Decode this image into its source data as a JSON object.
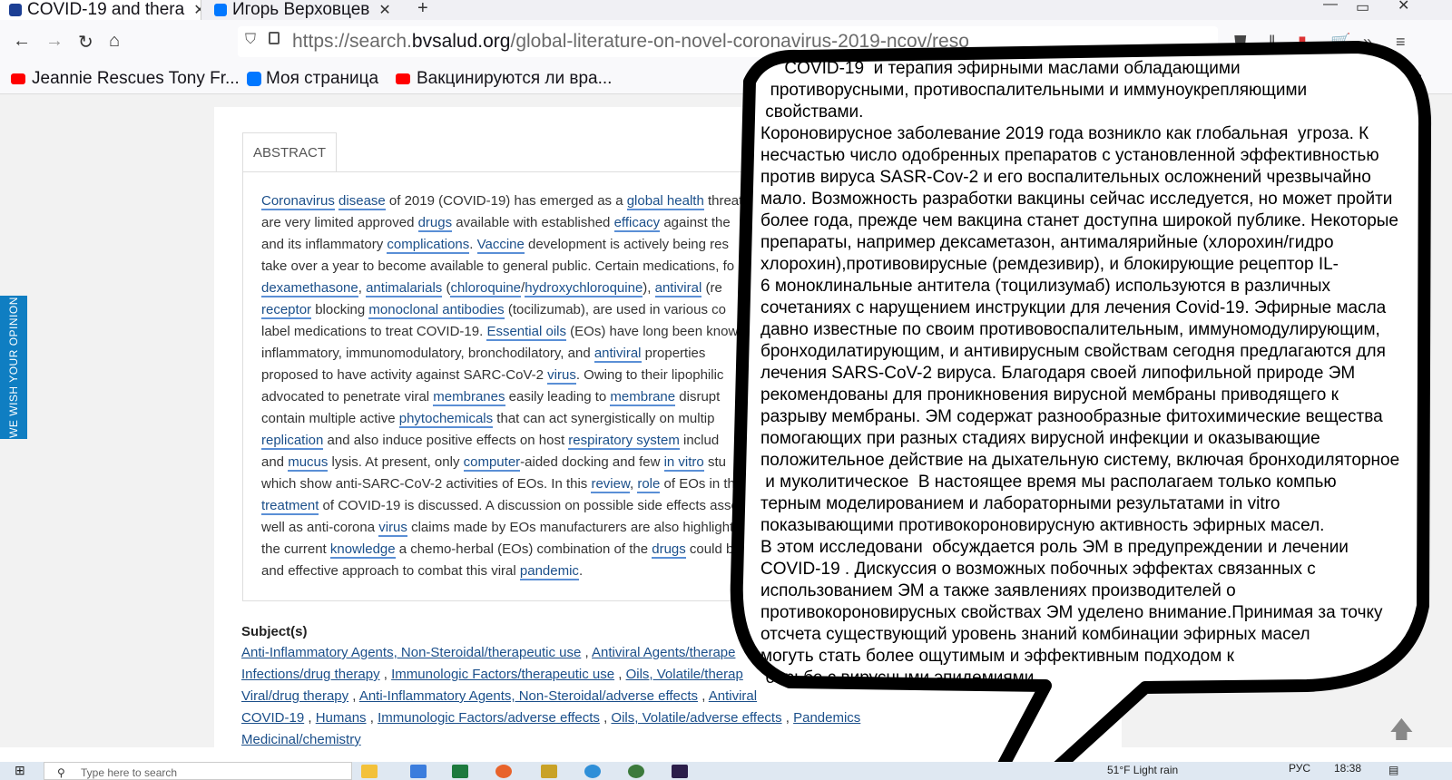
{
  "browser": {
    "tabs": [
      {
        "title": "COVID-19 and thera"
      },
      {
        "title": "Игорь Верховцев"
      }
    ],
    "new_tab": "+",
    "url_prefix": "https://search.",
    "url_domain": "bvsalud.org",
    "url_suffix": "/global-literature-on-novel-coronavirus-2019-ncov/reso",
    "bookmarks": [
      {
        "label": "Jeannie Rescues Tony Fr...",
        "icon": "youtube-icon"
      },
      {
        "label": "Моя страница",
        "icon": "vk-icon"
      },
      {
        "label": "Вакцинируются ли вра...",
        "icon": "youtube-icon"
      }
    ],
    "bookmarks_overflow": "ks"
  },
  "page": {
    "feedback_label": "WE WISH YOUR OPINION",
    "abstract_tab": "ABSTRACT",
    "abstract_lines": [
      [
        {
          "t": "Coronavirus",
          "k": true
        },
        {
          "t": " "
        },
        {
          "t": "disease",
          "k": true
        },
        {
          "t": " of 2019 (COVID-19) has emerged as a "
        },
        {
          "t": "global health",
          "k": true
        },
        {
          "t": " threat."
        }
      ],
      [
        {
          "t": "are very limited approved "
        },
        {
          "t": "drugs",
          "k": true
        },
        {
          "t": " available with established "
        },
        {
          "t": "efficacy",
          "k": true
        },
        {
          "t": " against the"
        }
      ],
      [
        {
          "t": "and its inflammatory "
        },
        {
          "t": "complications",
          "k": true
        },
        {
          "t": ". "
        },
        {
          "t": "Vaccine",
          "k": true
        },
        {
          "t": " development is actively being res"
        }
      ],
      [
        {
          "t": "take over a year to become available to general public. Certain medications, fo"
        }
      ],
      [
        {
          "t": "dexamethasone",
          "k": true
        },
        {
          "t": ", "
        },
        {
          "t": "antimalarials",
          "k": true
        },
        {
          "t": " ("
        },
        {
          "t": "chloroquine",
          "k": true
        },
        {
          "t": "/"
        },
        {
          "t": "hydroxychloroquine",
          "k": true
        },
        {
          "t": "), "
        },
        {
          "t": "antiviral",
          "k": true
        },
        {
          "t": " (re"
        }
      ],
      [
        {
          "t": "receptor",
          "k": true
        },
        {
          "t": " blocking "
        },
        {
          "t": "monoclonal antibodies",
          "k": true
        },
        {
          "t": " (tocilizumab), are used in various co"
        }
      ],
      [
        {
          "t": "label medications to treat COVID-19. "
        },
        {
          "t": "Essential oils",
          "k": true
        },
        {
          "t": " (EOs) have long been know"
        }
      ],
      [
        {
          "t": "inflammatory, immunomodulatory, bronchodilatory, and "
        },
        {
          "t": "antiviral",
          "k": true
        },
        {
          "t": " properties"
        }
      ],
      [
        {
          "t": "proposed to have activity against SARC-CoV-2 "
        },
        {
          "t": "virus",
          "k": true
        },
        {
          "t": ". Owing to their lipophilic"
        }
      ],
      [
        {
          "t": "advocated to penetrate viral "
        },
        {
          "t": "membranes",
          "k": true
        },
        {
          "t": " easily leading to "
        },
        {
          "t": "membrane",
          "k": true
        },
        {
          "t": " disrupt"
        }
      ],
      [
        {
          "t": "contain multiple active "
        },
        {
          "t": "phytochemicals",
          "k": true
        },
        {
          "t": " that can act synergistically on multip"
        }
      ],
      [
        {
          "t": "replication",
          "k": true
        },
        {
          "t": " and also induce positive effects on host "
        },
        {
          "t": "respiratory system",
          "k": true
        },
        {
          "t": " includ"
        }
      ],
      [
        {
          "t": "and "
        },
        {
          "t": "mucus",
          "k": true
        },
        {
          "t": " lysis. At present, only "
        },
        {
          "t": "computer",
          "k": true
        },
        {
          "t": "-aided docking and few "
        },
        {
          "t": "in vitro",
          "k": true
        },
        {
          "t": " stu"
        }
      ],
      [
        {
          "t": "which show anti-SARC-CoV-2 activities of EOs. In this "
        },
        {
          "t": "review",
          "k": true
        },
        {
          "t": ", "
        },
        {
          "t": "role",
          "k": true
        },
        {
          "t": " of EOs in the"
        }
      ],
      [
        {
          "t": "treatment",
          "k": true
        },
        {
          "t": " of COVID-19 is discussed. A discussion on possible side effects asso"
        }
      ],
      [
        {
          "t": "well as anti-corona "
        },
        {
          "t": "virus",
          "k": true
        },
        {
          "t": " claims made by EOs manufacturers are also highlight"
        }
      ],
      [
        {
          "t": "the current "
        },
        {
          "t": "knowledge",
          "k": true
        },
        {
          "t": " a chemo-herbal (EOs) combination of the "
        },
        {
          "t": "drugs",
          "k": true
        },
        {
          "t": " could b"
        }
      ],
      [
        {
          "t": "and effective approach to combat this viral "
        },
        {
          "t": "pandemic",
          "k": true
        },
        {
          "t": "."
        }
      ]
    ],
    "subjects_title": "Subject(s)",
    "subject_lines": [
      [
        "Anti-Inflammatory Agents, Non-Steroidal/therapeutic use",
        " , ",
        "Antiviral Agents/therape"
      ],
      [
        "Infections/drug therapy",
        " , ",
        "Immunologic Factors/therapeutic use",
        " , ",
        "Oils, Volatile/therap"
      ],
      [
        "Viral/drug therapy",
        " , ",
        "Anti-Inflammatory Agents, Non-Steroidal/adverse effects",
        " , ",
        "Antiviral"
      ],
      [
        "COVID-19",
        " , ",
        "Humans",
        " , ",
        "Immunologic Factors/adverse effects",
        " , ",
        "Oils, Volatile/adverse effects",
        " , ",
        "Pandemics"
      ],
      [
        "Medicinal/chemistry"
      ]
    ]
  },
  "bubble": {
    "text": "     COVID-19  и терапия эфирными маслами обладающими\n  противорусными, противоспалительными и иммуноукрепляющими\n свойствами.\nКороновирусное заболевание 2019 года возникло как глобальная  угроза. К\nнесчастью число одобренных препаратов с установленной эффективностью\nпротив вируса SASR-Cov-2 и его воспалительных осложнений чрезвычайно\nмало. Возможность разработки вакцины сейчас исследуется, но может пройти\nболее года, прежде чем вакцина станет доступна широкой публике. Некоторые\nпрепараты, например дексаметазон, антималярийные (хлорохин/гидро\nхлорохин),противовирусные (ремдезивир), и блокирующие рецептор IL-\n6 моноклинальные антитела (тоцилизумаб) используются в различных\nсочетаниях с нарущением инструкции для лечения Covid-19. Эфирные масла\nдавно известные по своим противовоспалительным, иммуномодулирующим,\nбронходилатирующим, и антивирусным свойствам сегодня предлагаются для\nлечения SARS-CoV-2 вируса. Благодаря своей липофильной природе ЭМ\nрекомендованы для проникновения вирусной мембраны приводящего к\nразрыву мембраны. ЭМ содержат разнообразные фитохимические вещества\nпомогающих при разных стадиях вирусной инфекции и оказывающие\nположительное действие на дыхательную систему, включая бронходиляторное\n и муколитическое  В настоящее время мы располагаем только компью\nтерным моделированием и лабораторными результатами in vitro\nпоказывающими противокороновирусную активность эфирных масел.\nВ этом исследовани  обсуждается роль ЭМ в предупреждении и лечении\nCOVID-19 . Дискуссия о возможных побочных эффектах связанных с\nиспользованием ЭМ а также заявлениях производителей о\nпротивокороновирусных свойствах ЭМ уделено внимание.Принимая за точку\nотсчета существующий уровень знаний комбинации эфирных масел\nмогуть стать более ощутимым и эффективным подходом к\n борьбе с вирусными эпидемиями."
  },
  "taskbar": {
    "search_placeholder": "Type here to search",
    "weather": "51°F  Light rain",
    "language": "РУС",
    "time": "18:38"
  }
}
